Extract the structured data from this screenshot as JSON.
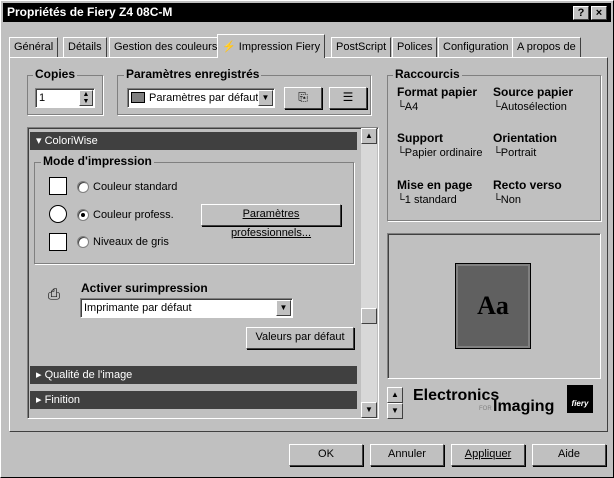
{
  "window": {
    "title": "Propriétés de Fiery Z4 08C-M",
    "help_btn": "?",
    "close_btn": "×"
  },
  "tabs": [
    {
      "label": "Général"
    },
    {
      "label": "Détails"
    },
    {
      "label": "Gestion des couleurs"
    },
    {
      "label": "Impression Fiery",
      "icon": "fiery-icon"
    },
    {
      "label": "PostScript"
    },
    {
      "label": "Polices"
    },
    {
      "label": "Configuration"
    },
    {
      "label": "A propos de"
    }
  ],
  "copies": {
    "label": "Copies",
    "value": "1"
  },
  "saved": {
    "label": "Paramètres enregistrés",
    "selected": "Paramètres par défaut"
  },
  "colorwise": {
    "header": "ColoriWise",
    "mode_label": "Mode d'impression",
    "options": [
      {
        "label": "Couleur standard",
        "selected": false
      },
      {
        "label": "Couleur profess.",
        "selected": true
      },
      {
        "label": "Niveaux de gris",
        "selected": false
      }
    ],
    "pro_button": "Paramètres professionnels...",
    "overprint_label": "Activer surimpression",
    "overprint_value": "Imprimante par défaut",
    "defaults_button": "Valeurs par défaut"
  },
  "sections": {
    "image_quality": "Qualité de l'image",
    "finishing": "Finition"
  },
  "shortcuts": {
    "label": "Raccourcis",
    "items": [
      {
        "title": "Format papier",
        "value": "A4"
      },
      {
        "title": "Source papier",
        "value": "Autosélection"
      },
      {
        "title": "Support",
        "value": "Papier ordinaire"
      },
      {
        "title": "Orientation",
        "value": "Portrait"
      },
      {
        "title": "Mise en page",
        "value": "1 standard"
      },
      {
        "title": "Recto verso",
        "value": "Non"
      }
    ]
  },
  "preview": {
    "text": "Aa"
  },
  "logo": {
    "brand1": "Electronics",
    "brand_small": "FOR",
    "brand2": "Imaging",
    "fiery": "fiery"
  },
  "buttons": {
    "ok": "OK",
    "cancel": "Annuler",
    "apply": "Appliquer",
    "help": "Aide"
  }
}
